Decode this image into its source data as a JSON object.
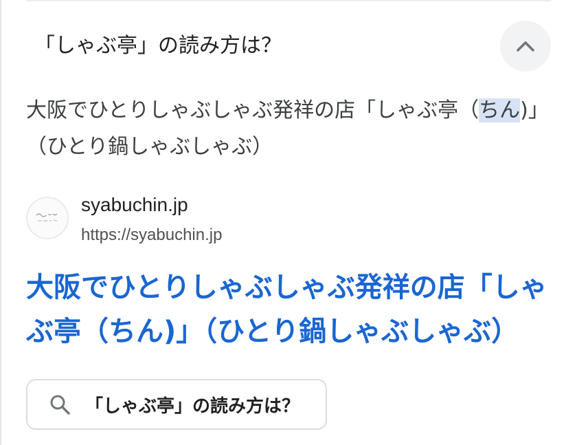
{
  "accordion": {
    "question": "「しゃぶ亭」の読み方は？",
    "collapse_icon": "chevron-up-icon",
    "answer_before": "大阪でひとりしゃぶしゃぶ発祥の店「しゃぶ亭（",
    "answer_highlight_1": "ち",
    "answer_highlight_2": "ん",
    "answer_after": ")」（ひとり鍋しゃぶしゃぶ）"
  },
  "source": {
    "favicon_icon": "site-logo-icon",
    "site_name": "syabuchin.jp",
    "url": "https://syabuchin.jp"
  },
  "result": {
    "title": "大阪でひとりしゃぶしゃぶ発祥の店「しゃぶ亭（ちん)」（ひとり鍋しゃぶしゃぶ）"
  },
  "search_chip": {
    "icon": "search-icon",
    "label": "「しゃぶ亭」の読み方は？"
  },
  "colors": {
    "link_blue": "#1a66d2",
    "highlight": "#d7e3f5",
    "chip_border": "#dadce0",
    "button_bg": "#f1f3f4"
  }
}
